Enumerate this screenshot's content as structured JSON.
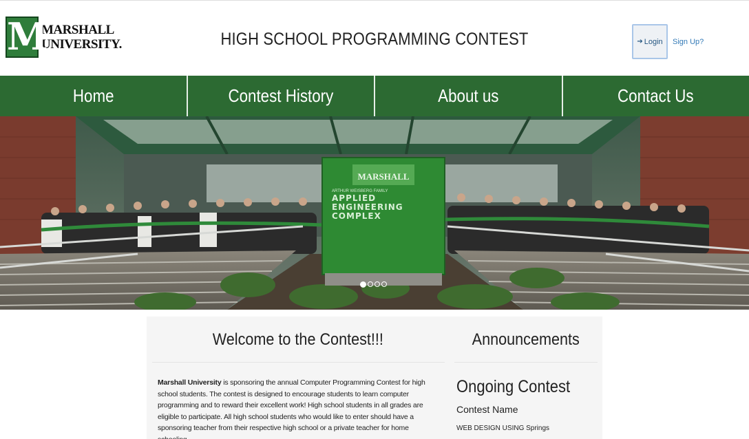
{
  "header": {
    "logo_line1": "MARSHALL",
    "logo_line2": "UNIVERSITY.",
    "title": "HIGH SCHOOL PROGRAMMING CONTEST",
    "login_label": "Login",
    "signup_label": "Sign Up?"
  },
  "nav": {
    "items": [
      {
        "label": "Home"
      },
      {
        "label": "Contest History"
      },
      {
        "label": "About us"
      },
      {
        "label": "Contact Us"
      }
    ]
  },
  "hero": {
    "sign_line1": "ARTHUR WEISBERG FAMILY",
    "sign_line2": "APPLIED",
    "sign_line3": "ENGINEERING",
    "sign_line4": "COMPLEX",
    "sign_logo": "MARSHALL",
    "slide_count": 4,
    "active_slide": 1
  },
  "welcome": {
    "title": "Welcome to the Contest!!!",
    "bold_lead": "Marshall University",
    "body": " is sponsoring the annual Computer Programming Contest for high school students. The contest is designed to encourage students to learn computer programming and to reward their excellent work! High school students in all grades are eligible to participate. All high school students who would like to enter should have a sponsoring teacher from their respective high school or a private teacher for home schooling."
  },
  "announcements": {
    "title": "Announcements",
    "section_heading": "Ongoing Contest",
    "contest_name_label": "Contest Name",
    "contest_name_value": "WEB DESIGN USING Springs"
  },
  "colors": {
    "brand_green": "#2c6a32",
    "link_blue": "#337ab7"
  }
}
